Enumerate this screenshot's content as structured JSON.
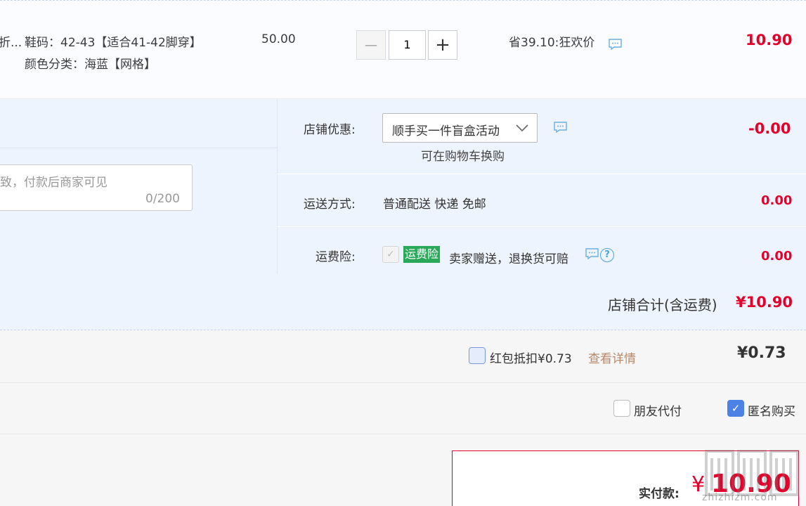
{
  "item": {
    "title_fragment": "折...",
    "size_label": "鞋码：42-43【适合41-42脚穿】",
    "color_label": "颜色分类：海蓝【网格】",
    "unit_price": "50.00",
    "quantity": "1",
    "minus_label": "—",
    "plus_label": "+",
    "discount_text": "省39.10:狂欢价",
    "subtotal": "10.90"
  },
  "memo": {
    "placeholder": "致，付款后商家可见",
    "counter": "0/200"
  },
  "shop_promo": {
    "label": "店铺优惠:",
    "selected": "顺手买一件盲盒活动",
    "note": "可在购物车换购",
    "amount": "-0.00"
  },
  "shipping": {
    "label": "运送方式:",
    "value": "普通配送 快递 免邮",
    "amount": "0.00"
  },
  "insurance": {
    "label": "运费险:",
    "tag": "运费险",
    "desc": "卖家赠送，退换货可赔",
    "amount": "0.00"
  },
  "shop_total": {
    "label": "店铺合计(含运费)",
    "amount": "¥10.90"
  },
  "red_packet": {
    "label": "红包抵扣¥0.73",
    "link": "查看详情",
    "amount": "¥0.73"
  },
  "options": {
    "friend_pay": "朋友代付",
    "anonymous": "匿名购买",
    "anonymous_checked": true
  },
  "payment": {
    "label": "实付款:",
    "currency": "¥",
    "amount": "10.90"
  },
  "watermark": {
    "text": "zhizhizm.com"
  },
  "colors": {
    "price_red": "#e4002b",
    "panel_blue": "#eef4fd",
    "check_blue": "#4c82e6",
    "tag_green": "#2aa85a",
    "link_brown": "#b8886b"
  }
}
